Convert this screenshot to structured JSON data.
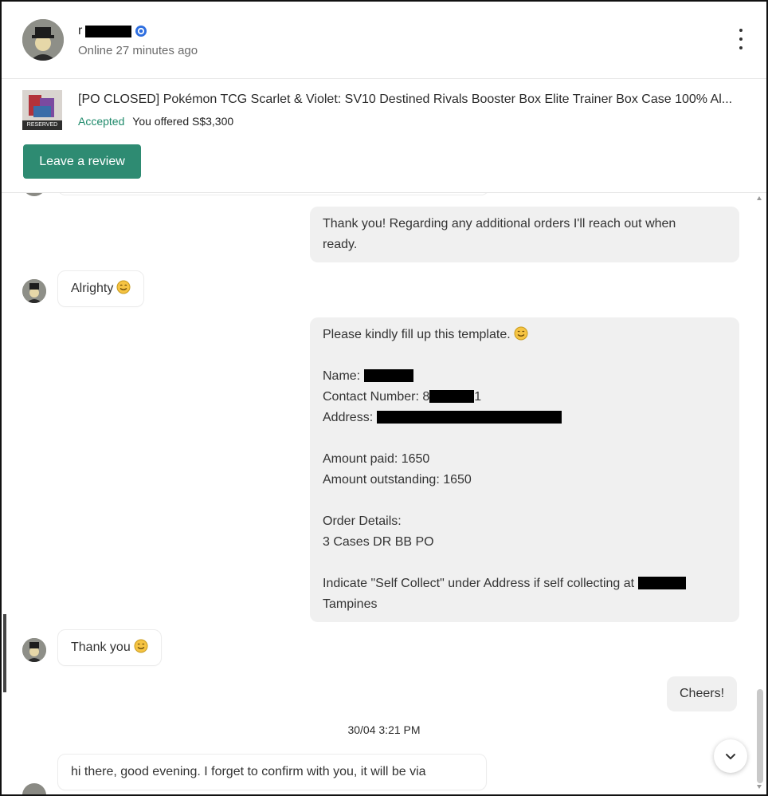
{
  "header": {
    "username": "r",
    "online_status": "Online 27 minutes ago"
  },
  "listing": {
    "thumb_badge": "RESERVED",
    "title": "[PO CLOSED] Pokémon TCG Scarlet & Violet: SV10 Destined Rivals Booster Box Elite Trainer Box Case 100% Al...",
    "status": "Accepted",
    "offer": "You offered S$3,300",
    "review_button": "Leave a review"
  },
  "messages": {
    "m1": {
      "line1": "Thank you! Regarding any additional orders I'll reach out when",
      "line2": "ready."
    },
    "m2": {
      "text": "Alrighty"
    },
    "m3": {
      "intro": "Please kindly fill up this template.",
      "name_label": "Name: ",
      "contact_label": "Contact Number: 8",
      "contact_tail": "1",
      "address_label": "Address: ",
      "amount_paid": "Amount paid: 1650",
      "amount_outstanding": "Amount outstanding: 1650",
      "order_details_label": "Order Details:",
      "order_details": "3 Cases DR BB PO",
      "self_collect_line1": "Indicate \"Self Collect\" under Address if self collecting at ",
      "self_collect_line2": "Tampines"
    },
    "m4": {
      "text": "Thank you"
    },
    "m5": {
      "text": "Cheers!"
    },
    "date_separator": "30/04  3:21 PM",
    "m6": {
      "text": "hi there, good evening. I forget to confirm with you, it will be via"
    }
  },
  "icons": {
    "verified": "verified-badge-icon",
    "more": "more-vertical-icon",
    "emoji": "smiling-face-emoji-icon",
    "scroll_down": "chevron-down-icon"
  },
  "colors": {
    "accent_green": "#2e8b72",
    "accepted_text": "#1f8a6b",
    "verified_blue": "#2f6fe0",
    "bubble_gray": "#f0f0f0",
    "emoji_yellow": "#f6c443"
  }
}
